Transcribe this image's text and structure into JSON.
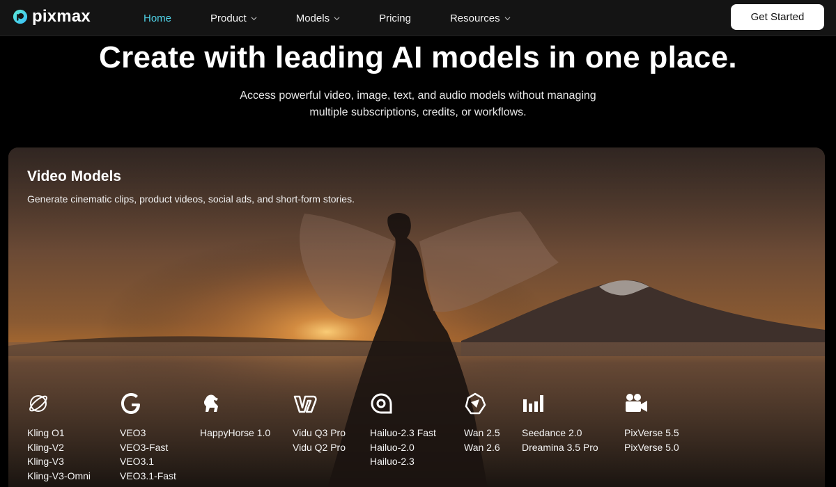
{
  "nav": {
    "logo_text": "pixmax",
    "links": [
      {
        "label": "Home",
        "has_dropdown": false,
        "active": true
      },
      {
        "label": "Product",
        "has_dropdown": true,
        "active": false
      },
      {
        "label": "Models",
        "has_dropdown": true,
        "active": false
      },
      {
        "label": "Pricing",
        "has_dropdown": false,
        "active": false
      },
      {
        "label": "Resources",
        "has_dropdown": true,
        "active": false
      }
    ],
    "cta_label": "Get Started"
  },
  "hero": {
    "title": "Create with leading AI models in one place.",
    "subtitle": "Access powerful video, image, text, and audio models without managing multiple subscriptions, credits, or workflows."
  },
  "video_models": {
    "title": "Video Models",
    "subtitle": "Generate cinematic clips, product videos, social ads, and short-form stories.",
    "providers": [
      {
        "icon": "kling-icon",
        "models": [
          "Kling O1",
          "Kling-V2",
          "Kling-V3",
          "Kling-V3-Omni"
        ]
      },
      {
        "icon": "google-icon",
        "models": [
          "VEO3",
          "VEO3-Fast",
          "VEO3.1",
          "VEO3.1-Fast"
        ]
      },
      {
        "icon": "happyhorse-icon",
        "models": [
          "HappyHorse 1.0"
        ]
      },
      {
        "icon": "vidu-icon",
        "models": [
          "Vidu Q3 Pro",
          "Vidu Q2 Pro"
        ]
      },
      {
        "icon": "hailuo-icon",
        "models": [
          "Hailuo-2.3 Fast",
          "Hailuo-2.0",
          "Hailuo-2.3"
        ]
      },
      {
        "icon": "wan-icon",
        "models": [
          "Wan 2.5",
          "Wan 2.6"
        ]
      },
      {
        "icon": "seedance-icon",
        "models": [
          "Seedance 2.0",
          "Dreamina 3.5 Pro"
        ]
      },
      {
        "icon": "pixverse-icon",
        "models": [
          "PixVerse 5.5",
          "PixVerse 5.0"
        ]
      }
    ]
  },
  "colors": {
    "accent": "#4fd1e6",
    "nav_bg": "#141414",
    "page_bg": "#000000",
    "cta_bg": "#ffffff"
  }
}
